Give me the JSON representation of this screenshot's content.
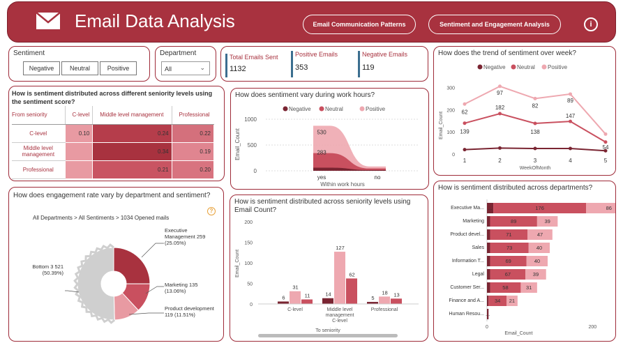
{
  "header": {
    "title": "Email Data Analysis",
    "btn1": "Email Communication Patterns",
    "btn2": "Sentiment and Engagement Analysis",
    "info": "i"
  },
  "sentiment_slicer": {
    "label": "Sentiment",
    "options": [
      "Negative",
      "Neutral",
      "Positive"
    ]
  },
  "department_slicer": {
    "label": "Department",
    "value": "All"
  },
  "kpis": {
    "total_label": "Total Emails Sent",
    "total_value": "1132",
    "pos_label": "Positive Emails",
    "pos_value": "353",
    "neg_label": "Negative Emails",
    "neg_value": "119"
  },
  "colors": {
    "negative": "#7a2532",
    "neutral": "#c9505f",
    "positive": "#eea8b0",
    "accent": "#a8323f",
    "kpi_bar": "#3b6e8f"
  },
  "matrix": {
    "title": "How is sentiment distributed across different seniority levels using the sentiment score?",
    "corner": "From seniority",
    "columns": [
      "C-level",
      "Middle level management",
      "Professional"
    ],
    "rows": [
      {
        "label": "C-level",
        "values": [
          "0.10",
          "0.24",
          "0.22"
        ]
      },
      {
        "label": "Middle level management",
        "values": [
          "",
          "0.34",
          "0.19"
        ]
      },
      {
        "label": "Professional",
        "values": [
          "",
          "0.21",
          "0.20"
        ]
      }
    ]
  },
  "engagement": {
    "title": "How does engagement rate vary by department and sentiment?",
    "breadcrumb": "All Departments > All Sentiments > 1034 Opened mails",
    "help": "?",
    "labels": {
      "exec": "Executive Management 259 (25.05%)",
      "exec_l1": "Executive",
      "exec_l2": "Management 259",
      "exec_l3": "(25.05%)",
      "mkt_l1": "Marketing 135",
      "mkt_l2": "(13.06%)",
      "prod_l1": "Product development",
      "prod_l2": "119 (11.51%)",
      "bottom_l1": "Bottom 3 521",
      "bottom_l2": "(50.39%)"
    }
  },
  "chart_data": [
    {
      "type": "area",
      "title": "How does sentiment vary during work hours?",
      "legend": [
        "Negative",
        "Neutral",
        "Positive"
      ],
      "categories": [
        "yes",
        "no"
      ],
      "xlabel": "Within work hours",
      "ylabel": "Email_Count",
      "yticks": [
        "0",
        "500",
        "1000"
      ],
      "ylim": [
        0,
        1000
      ],
      "labels": [
        "530",
        "283"
      ],
      "series": [
        {
          "name": "Negative",
          "values": [
            60,
            15
          ]
        },
        {
          "name": "Neutral",
          "values": [
            283,
            30
          ]
        },
        {
          "name": "Positive",
          "values": [
            530,
            40
          ]
        }
      ]
    },
    {
      "type": "line",
      "title": "How does the trend of sentiment over week?",
      "legend": [
        "Negative",
        "Neutral",
        "Positive"
      ],
      "x": [
        1,
        2,
        3,
        4,
        5
      ],
      "xlabel": "WeekOfMonth",
      "ylabel": "Email_Count",
      "yticks": [
        "0",
        "100",
        "200",
        "300"
      ],
      "ylim": [
        0,
        320
      ],
      "series": [
        {
          "name": "Negative",
          "values": [
            20,
            27,
            25,
            25,
            15
          ]
        },
        {
          "name": "Neutral",
          "values": [
            139,
            182,
            138,
            147,
            54
          ]
        },
        {
          "name": "Positive",
          "values": [
            225,
            305,
            250,
            270,
            90
          ]
        }
      ],
      "data_labels": [
        "62",
        "97",
        "82",
        "89",
        "139",
        "182",
        "138",
        "147",
        "54"
      ]
    },
    {
      "type": "bar",
      "title": "How is sentiment distributed across seniority levels using Email Count?",
      "legend": [
        "Negative",
        "Neutral",
        "Positive"
      ],
      "categories": [
        "C-level",
        "Middle level management C-level",
        "Professional"
      ],
      "xlabel": "To seniority",
      "ylabel": "Email_Count",
      "yticks": [
        "0",
        "50",
        "100",
        "150",
        "200"
      ],
      "ylim": [
        0,
        200
      ],
      "series": [
        {
          "name": "Negative",
          "values": [
            6,
            14,
            5
          ]
        },
        {
          "name": "Positive",
          "values": [
            31,
            127,
            18
          ]
        },
        {
          "name": "Neutral",
          "values": [
            11,
            62,
            13
          ]
        }
      ]
    },
    {
      "type": "bar",
      "title": "How is sentiment distributed across departments?",
      "categories": [
        "Executive Ma...",
        "Marketing",
        "Product devel...",
        "Sales",
        "Information T...",
        "Legal",
        "Customer Ser...",
        "Finance and A...",
        "Human Resou..."
      ],
      "xlabel": "Email_Count",
      "xticks": [
        "0",
        "200"
      ],
      "xlim": [
        0,
        230
      ],
      "series": [
        {
          "name": "Negative",
          "values": [
            12,
            6,
            6,
            6,
            6,
            6,
            6,
            3,
            3
          ],
          "labels": [
            "...",
            "",
            "",
            "",
            "",
            "",
            "",
            "",
            "..."
          ]
        },
        {
          "name": "Neutral",
          "values": [
            176,
            89,
            71,
            73,
            69,
            67,
            58,
            34,
            0
          ],
          "labels": [
            "176",
            "89",
            "71",
            "73",
            "69",
            "67",
            "58",
            "34",
            ""
          ]
        },
        {
          "name": "Positive",
          "values": [
            86,
            39,
            47,
            40,
            40,
            39,
            31,
            21,
            0
          ],
          "labels": [
            "86",
            "39",
            "47",
            "40",
            "40",
            "39",
            "31",
            "21",
            ""
          ]
        }
      ]
    }
  ]
}
